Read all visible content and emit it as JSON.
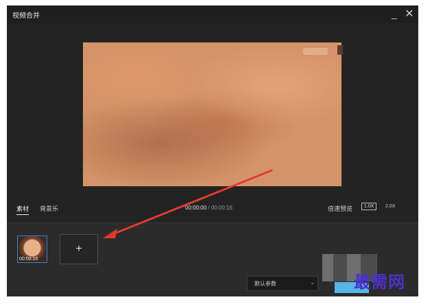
{
  "window": {
    "title": "视频合并",
    "minimize_glyph": "_",
    "close_glyph": "✕"
  },
  "preview": {
    "tab_material": "素材",
    "tab_music": "背景乐",
    "time_current": "00:00:00",
    "time_separator": " / ",
    "time_total": "00:00:16",
    "speed_label": "倍速预览",
    "speed_1x": "1.0X",
    "speed_2x": "2.0X"
  },
  "track": {
    "clip_time": "00:00:16",
    "add_glyph": "+",
    "param_select": "默认参数",
    "select_chevron": "⌄"
  },
  "watermark": "最需网",
  "colors": {
    "window_bg": "#232323",
    "accent_blue": "#3a7fd5",
    "arrow_red": "#e33b2f",
    "watermark": "#4a33c9"
  }
}
